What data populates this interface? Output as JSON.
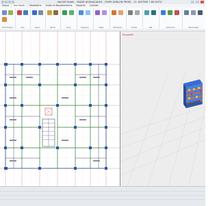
{
  "app": {
    "title": "ideCAD Statik - YAŞAR ALMAAÇAKA3 - CİHPK ŞABLON PROJE - 11. KATTAKİ 7.80 KOTU"
  },
  "tabs": [
    "Dosya",
    "Ana Sayfa",
    "Modelleme",
    "Analiz ve Boyutlandırma",
    "Raporlar",
    "Çizimler"
  ],
  "ribbon_groups": [
    "Hızlı Erişim",
    "Aks",
    "Kolon",
    "Perde",
    "Kiriş",
    "Döşeme",
    "Kalıp",
    "Merdiven",
    "Temel",
    "Kat",
    "Görünüm",
    "Pencereler"
  ],
  "viewport": {
    "right_label": "Perspektif"
  },
  "colors": {
    "accent": "#2a5fa8",
    "axis_red": "#d23b3b",
    "column": "#2c55a8",
    "beam_green": "#2f8f3f",
    "slab": "#3a6bd1"
  }
}
